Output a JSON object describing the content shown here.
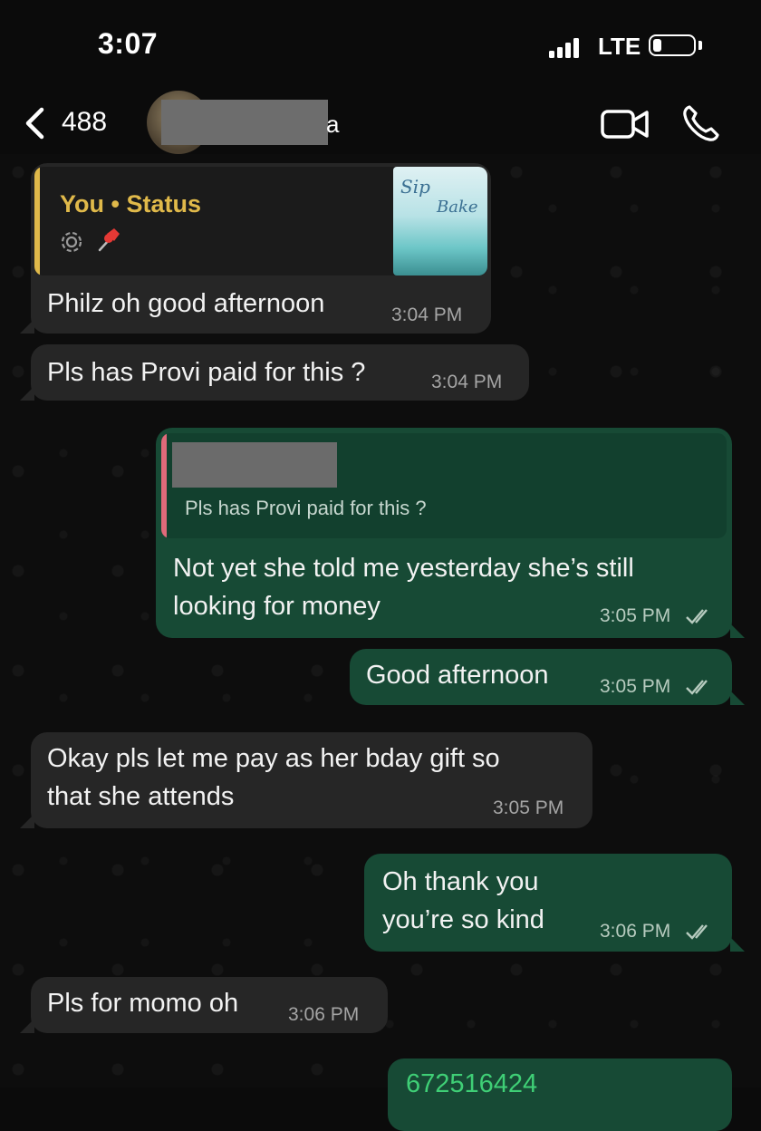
{
  "status_bar": {
    "time": "3:07",
    "network": "LTE"
  },
  "header": {
    "back_count": "488",
    "name_suffix": "a"
  },
  "messages": {
    "m1": {
      "quote_title": "You • Status",
      "quote_icons": [
        "status-icon",
        "pin-icon"
      ],
      "thumb_title": "Sip",
      "thumb_title2": "Bake",
      "text": "Philz oh good afternoon",
      "time": "3:04 PM"
    },
    "m2": {
      "text": "Pls has Provi paid for this ?",
      "time": "3:04 PM"
    },
    "m3": {
      "quote_text": "Pls has Provi paid for this ?",
      "text": "Not yet she told me yesterday she’s still\nlooking for money",
      "time": "3:05 PM"
    },
    "m4": {
      "text": "Good afternoon",
      "time": "3:05 PM"
    },
    "m5": {
      "text": "Okay pls let me pay as her bday gift so\nthat she attends",
      "time": "3:05 PM"
    },
    "m6": {
      "text": "Oh thank you\n you’re so kind",
      "time": "3:06 PM"
    },
    "m7": {
      "text": "Pls for momo oh",
      "time": "3:06 PM"
    },
    "m8": {
      "text": "672516424"
    }
  },
  "colors": {
    "incoming": "#262626",
    "outgoing": "#174a35",
    "status_quote_bar": "#e0b94a",
    "reply_quote_bar": "#e06a7a",
    "link": "#3fcf76"
  }
}
